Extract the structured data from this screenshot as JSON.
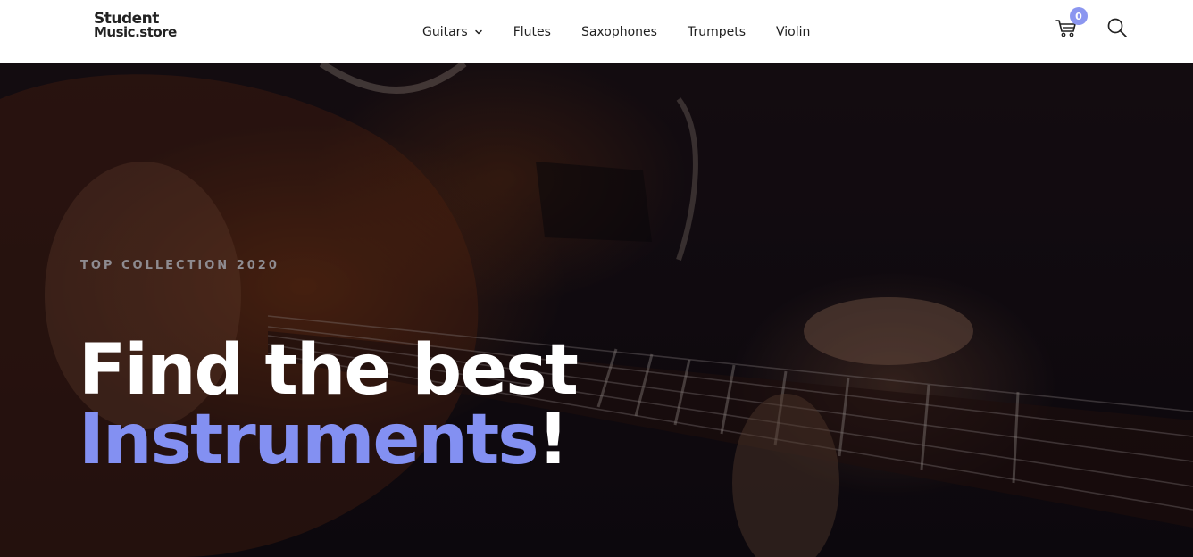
{
  "brand": {
    "line1": "Student",
    "line2": "Music.store"
  },
  "nav": {
    "items": [
      {
        "label": "Guitars",
        "has_dropdown": true
      },
      {
        "label": "Flutes"
      },
      {
        "label": "Saxophones"
      },
      {
        "label": "Trumpets"
      },
      {
        "label": "Violin"
      }
    ]
  },
  "cart": {
    "count": "0",
    "icon": "cart-icon"
  },
  "search": {
    "icon": "search-icon"
  },
  "hero": {
    "eyebrow": "TOP COLLECTION 2020",
    "headline_line1": "Find the best",
    "headline_accent": "Instruments",
    "headline_end": "!"
  },
  "colors": {
    "accent": "#8390f2",
    "badge": "#8b96f0",
    "hero_bg": "#140d10"
  }
}
